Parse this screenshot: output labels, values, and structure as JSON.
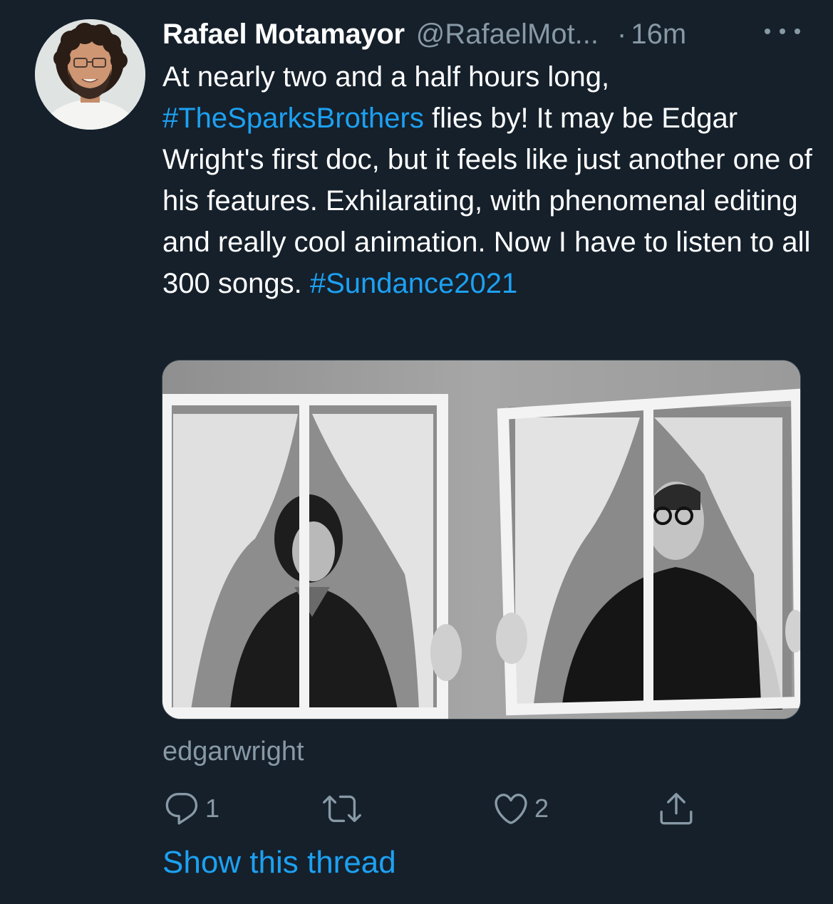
{
  "tweet": {
    "display_name": "Rafael Motamayor",
    "handle": "@RafaelMot...",
    "separator": "·",
    "time": "16m",
    "text_parts": {
      "p1": "At nearly two and a half hours long, ",
      "hashtag1": "#TheSparksBrothers",
      "p2": " flies by! It may be Edgar Wright's first doc, but it feels like just another one of his features. Exhilarating, with phenomenal editing and really cool animation. Now I have to listen to all 300 songs. ",
      "hashtag2": "#Sundance2021"
    },
    "media_credit": "edgarwright",
    "show_thread_label": "Show this thread"
  },
  "actions": {
    "reply": {
      "icon": "reply-icon",
      "count": "1"
    },
    "retweet": {
      "icon": "retweet-icon",
      "count": ""
    },
    "like": {
      "icon": "heart-icon",
      "count": "2"
    },
    "share": {
      "icon": "share-icon"
    }
  },
  "colors": {
    "background": "#15202b",
    "accent": "#1da1f2",
    "secondary_text": "#8899a6",
    "primary_text": "#ffffff"
  }
}
